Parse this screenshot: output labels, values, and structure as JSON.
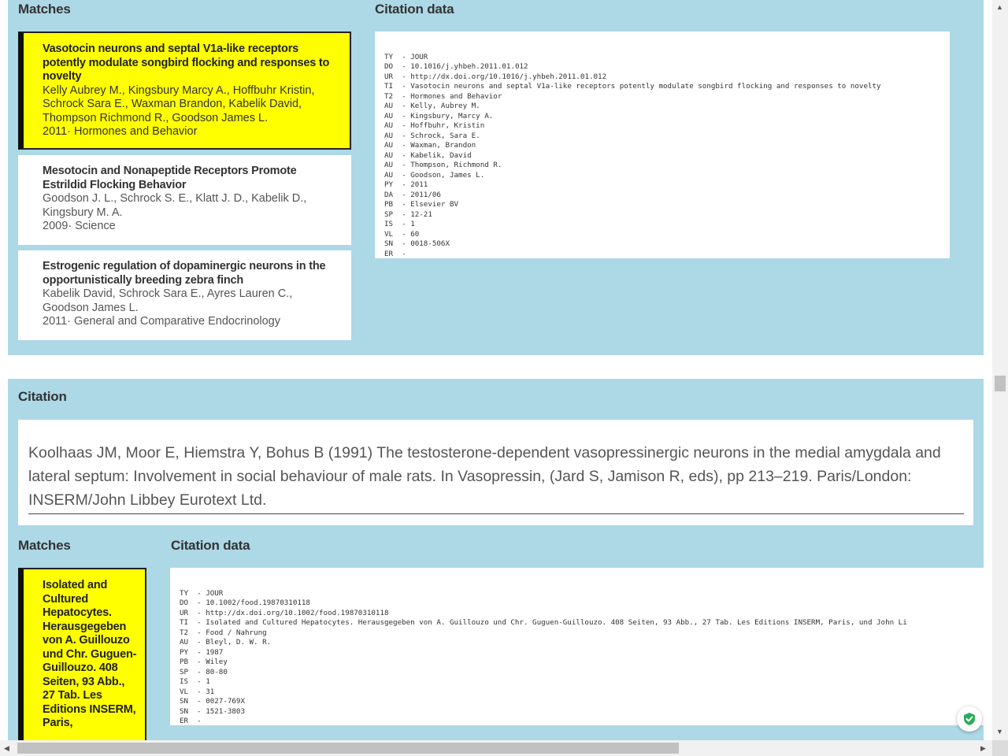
{
  "top_section": {
    "matches_heading": "Matches",
    "citation_data_heading": "Citation data",
    "matches": [
      {
        "title": "Vasotocin neurons and septal V1a-like receptors potently modulate songbird flocking and responses to novelty",
        "authors": "Kelly Aubrey M., Kingsbury Marcy A., Hoffbuhr Kristin, Schrock Sara E., Waxman Brandon, Kabelik David, Thompson Richmond R., Goodson James L.",
        "meta": "2011· Hormones and Behavior",
        "selected": true
      },
      {
        "title": "Mesotocin and Nonapeptide Receptors Promote Estrildid Flocking Behavior",
        "authors": "Goodson J. L., Schrock S. E., Klatt J. D., Kabelik D., Kingsbury M. A.",
        "meta": "2009· Science",
        "selected": false
      },
      {
        "title": "Estrogenic regulation of dopaminergic neurons in the opportunistically breeding zebra finch",
        "authors": "Kabelik David, Schrock Sara E., Ayres Lauren C., Goodson James L.",
        "meta": "2011· General and Comparative Endocrinology",
        "selected": false
      }
    ],
    "ris_lines": [
      "TY  - JOUR",
      "DO  - 10.1016/j.yhbeh.2011.01.012",
      "UR  - http://dx.doi.org/10.1016/j.yhbeh.2011.01.012",
      "TI  - Vasotocin neurons and septal V1a-like receptors potently modulate songbird flocking and responses to novelty",
      "T2  - Hormones and Behavior",
      "AU  - Kelly, Aubrey M.",
      "AU  - Kingsbury, Marcy A.",
      "AU  - Hoffbuhr, Kristin",
      "AU  - Schrock, Sara E.",
      "AU  - Waxman, Brandon",
      "AU  - Kabelik, David",
      "AU  - Thompson, Richmond R.",
      "AU  - Goodson, James L.",
      "PY  - 2011",
      "DA  - 2011/06",
      "PB  - Elsevier BV",
      "SP  - 12-21",
      "IS  - 1",
      "VL  - 60",
      "SN  - 0018-506X",
      "ER  - "
    ]
  },
  "bottom_section": {
    "citation_heading": "Citation",
    "citation_text": "Koolhaas JM, Moor E, Hiemstra Y, Bohus B (1991) The testosterone-dependent vasopressinergic neurons in the medial amygdala and lateral septum: Involvement in social behaviour of male rats. In Vasopressin, (Jard S, Jamison R, eds), pp 213–219. Paris/London: INSERM/John Libbey Eurotext Ltd.",
    "matches_heading": "Matches",
    "citation_data_heading": "Citation data",
    "matches": [
      {
        "title": "Isolated and Cultured Hepatocytes. Herausgegeben von A. Guillouzo und Chr. Guguen-Guillouzo. 408 Seiten, 93 Abb., 27 Tab. Les Editions INSERM, Paris,",
        "selected": true
      }
    ],
    "ris_lines": [
      "TY  - JOUR",
      "DO  - 10.1002/food.19870310118",
      "UR  - http://dx.doi.org/10.1002/food.19870310118",
      "TI  - Isolated and Cultured Hepatocytes. Herausgegeben von A. Guillouzo und Chr. Guguen-Guillouzo. 408 Seiten, 93 Abb., 27 Tab. Les Editions INSERM, Paris, und John Li",
      "T2  - Food / Nahrung",
      "AU  - Bleyl, D. W. R.",
      "PY  - 1987",
      "PB  - Wiley",
      "SP  - 80-80",
      "IS  - 1",
      "VL  - 31",
      "SN  - 0027-769X",
      "SN  - 1521-3803",
      "ER  - "
    ]
  },
  "colors": {
    "panel_bg": "#add8e6",
    "selected_bg": "#ffff00",
    "shield_green": "#2eaa5a"
  },
  "icons": {
    "shield": "shield-check-icon"
  }
}
